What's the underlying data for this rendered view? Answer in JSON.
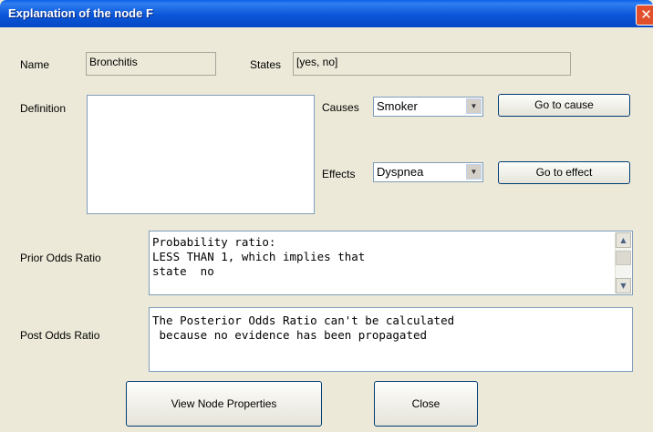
{
  "window": {
    "title": "Explanation of the node F",
    "close_glyph": "✕"
  },
  "name": {
    "label": "Name",
    "value": "Bronchitis"
  },
  "states": {
    "label": "States",
    "value": "[yes, no]"
  },
  "definition": {
    "label": "Definition",
    "value": ""
  },
  "causes": {
    "label": "Causes",
    "selected": "Smoker",
    "button": "Go to cause"
  },
  "effects": {
    "label": "Effects",
    "selected": "Dyspnea",
    "button": "Go to effect"
  },
  "prior_odds": {
    "label": "Prior Odds Ratio",
    "text": "Probability ratio:\nLESS THAN 1, which implies that\nstate  no"
  },
  "post_odds": {
    "label": "Post Odds Ratio",
    "text": "The Posterior Odds Ratio can't be calculated\n because no evidence has been propagated"
  },
  "buttons": {
    "view_node_properties": "View Node Properties",
    "close": "Close"
  },
  "icons": {
    "dropdown": "chevron-down-icon",
    "scroll_up": "scroll-up-icon",
    "scroll_down": "scroll-down-icon",
    "close": "close-icon"
  }
}
